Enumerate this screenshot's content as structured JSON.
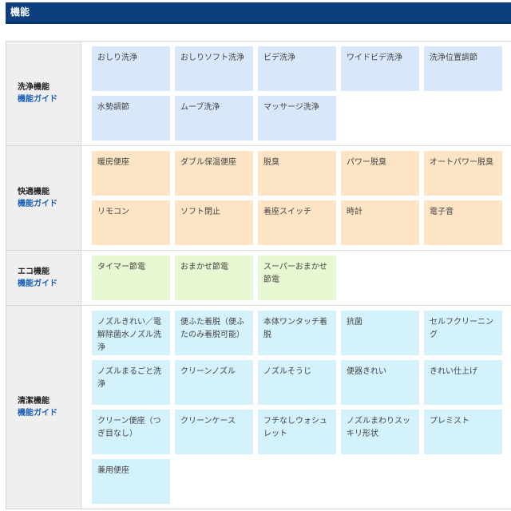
{
  "header": {
    "title": "機能"
  },
  "colors": {
    "header_bg": "#0d3f7f",
    "link": "#1a5fb4",
    "wash": "#d9e7fb",
    "comfort": "#fde4c5",
    "eco": "#e8f8d2",
    "clean": "#d3f2fc"
  },
  "sections": [
    {
      "title": "洗浄機能",
      "link": "機能ガイド",
      "color": "blue",
      "items": [
        "おしり洗浄",
        "おしりソフト洗浄",
        "ビデ洗浄",
        "ワイドビデ洗浄",
        "洗浄位置調節",
        "水勢調節",
        "ムーブ洗浄",
        "マッサージ洗浄"
      ]
    },
    {
      "title": "快適機能",
      "link": "機能ガイド",
      "color": "orange",
      "items": [
        "暖房便座",
        "ダブル保温便座",
        "脱臭",
        "パワー脱臭",
        "オートパワー脱臭",
        "リモコン",
        "ソフト閉止",
        "着座スイッチ",
        "時計",
        "電子音"
      ]
    },
    {
      "title": "エコ機能",
      "link": "機能ガイド",
      "color": "green",
      "items": [
        "タイマー節電",
        "おまかせ節電",
        "スーパーおまかせ節電"
      ]
    },
    {
      "title": "清潔機能",
      "link": "機能ガイド",
      "color": "cyan",
      "items": [
        "ノズルきれい／電解除菌水ノズル洗浄",
        "便ふた着脱（便ふたのみ着脱可能）",
        "本体ワンタッチ着脱",
        "抗菌",
        "セルフクリーニング",
        "ノズルまるごと洗浄",
        "クリーンノズル",
        "ノズルそうじ",
        "便器きれい",
        "きれい仕上げ",
        "クリーン便座（つぎ目なし）",
        "クリーンケース",
        "フチなしウォシュレット",
        "ノズルまわりスッキリ形状",
        "プレミスト",
        "兼用便座"
      ]
    }
  ]
}
